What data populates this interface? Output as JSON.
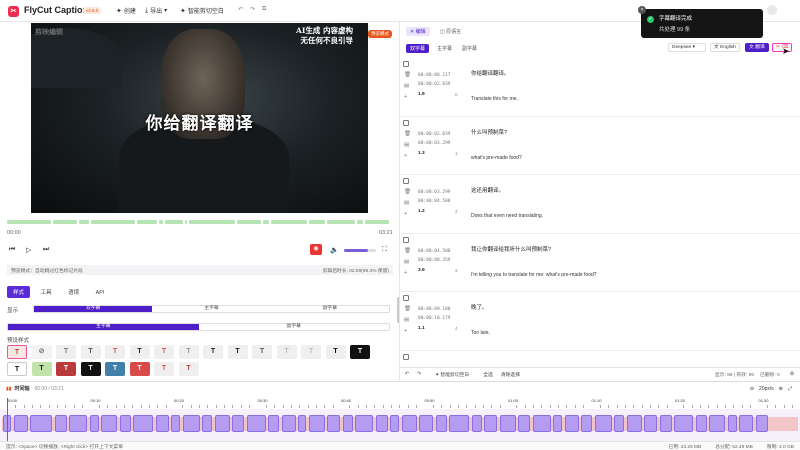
{
  "app": {
    "title": "FlyCut Caption",
    "version": "v2.8.0"
  },
  "toolbar": {
    "create": "创建",
    "export": "导出",
    "smart_cut": "智能剪切空白"
  },
  "toast": {
    "title": "字幕翻译完成",
    "detail": "共处理 99 条"
  },
  "video": {
    "watermark": "剪映编辑",
    "ai_line1": "AI生成 内容虚构",
    "ai_line2": "无任何不良引导",
    "preview_badge": "预览模式",
    "subtitle": "你给翻译翻译"
  },
  "player": {
    "current_time": "00:00",
    "total_time": "03:21"
  },
  "info": {
    "mode": "预览模式：自动跳过红色标记片段",
    "duration": "剪辑后时长: 02:59(89.3% 保留)"
  },
  "settings": {
    "tabs": [
      "样式",
      "工具",
      "语境",
      "API"
    ],
    "display_label": "显示",
    "display_options": [
      "双字幕",
      "主字幕",
      "副字幕"
    ],
    "track_options": [
      "主字幕",
      "副字幕"
    ],
    "preset_label": "预设样式",
    "preset_row1": [
      "T",
      "⊘",
      "T",
      "T",
      "T",
      "T",
      "T",
      "T",
      "T",
      "T",
      "T",
      "T",
      "T",
      "T",
      "T",
      "T",
      "T"
    ],
    "preset_row2": [
      "T",
      "T",
      "T",
      "T",
      "T",
      "T",
      "T",
      "T"
    ]
  },
  "right": {
    "mode_edit": "编辑",
    "mode_translate": "原语言",
    "sub_tabs": [
      "双字幕",
      "主字幕",
      "副字幕"
    ],
    "engine": "Deepsee",
    "lang": "English",
    "translate_btn": "翻译",
    "rows": [
      {
        "start": "00:00:00.117",
        "end": "00:00:02.039",
        "dur": "1.9",
        "idx": "0",
        "zh": "你给翻译翻译。",
        "en": "Translate this for me,"
      },
      {
        "start": "00:00:02.039",
        "end": "00:00:03.299",
        "dur": "1.3",
        "idx": "1",
        "zh": "什么叫预制菜?",
        "en": "what's pre-made food?"
      },
      {
        "start": "00:00:03.299",
        "end": "00:00:04.500",
        "dur": "1.2",
        "idx": "2",
        "zh": "这还用翻译。",
        "en": "Does that even need translating."
      },
      {
        "start": "00:00:04.500",
        "end": "00:00:08.359",
        "dur": "3.9",
        "idx": "3",
        "zh": "我让你翻译给我听什么叫预制菜?",
        "en": "I'm telling you to translate for me: what's pre-made food?"
      },
      {
        "start": "00:00:09.180",
        "end": "00:00:10.179",
        "dur": "1.1",
        "idx": "4",
        "zh": "晚了。",
        "en": "Too late,"
      }
    ],
    "bottom": {
      "smart_cut": "智能剪切空白",
      "select_all": "全选",
      "clear": "清除选择",
      "stats": "显示: 99 | 有效: 99",
      "deleted": "已删除: 0"
    }
  },
  "timeline": {
    "title": "时间轴",
    "time": "00:00 / 03:21",
    "zoom": "20px/s",
    "ruler": [
      "00:00",
      "00:10",
      "00:20",
      "00:30",
      "00:40",
      "00:50",
      "01:00",
      "01:10",
      "01:20",
      "01:30"
    ]
  },
  "footer": {
    "hint": "提示: <Space> 切换播放, <Right click> 打开上下文菜单",
    "used": "已用: 43.25 MB",
    "total": "总分配: 52.48 MB",
    "limit": "限制: 4.0 GB"
  }
}
